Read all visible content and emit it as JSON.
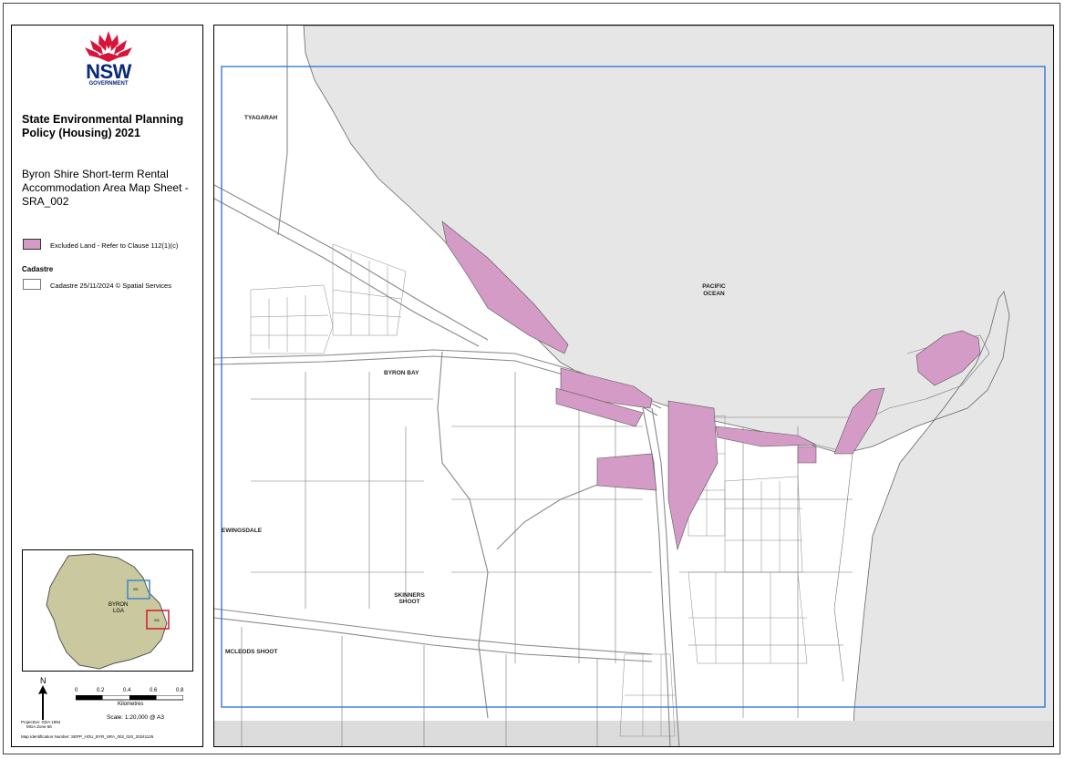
{
  "logo": {
    "wordmark": "NSW",
    "sub": "GOVERNMENT"
  },
  "title": "State Environmental Planning Policy (Housing) 2021",
  "subtitle": "Byron Shire Short-term Rental Accommodation Area Map Sheet - SRA_002",
  "legend": {
    "excluded_label": "Excluded Land - Refer to Clause 112(1)(c)",
    "excluded_color": "#d39bc6",
    "cadastre_heading": "Cadastre",
    "cadastre_label": "Cadastre 25/11/2024 © Spatial Services"
  },
  "inset": {
    "lga_label_1": "BYRON",
    "lga_label_2": "LGA",
    "sheet_a": "001",
    "sheet_b": "002",
    "lga_color": "#c9c89e"
  },
  "north": "N",
  "scale": {
    "ticks": [
      "0",
      "0.2",
      "0.4",
      "0.6",
      "0.8"
    ],
    "units": "Kilometres",
    "text": "Scale: 1:20,000 @ A3"
  },
  "projection": [
    "Projection: GDA 1994",
    "MGA Zone 56"
  ],
  "map_id": "Map Identification Number: SEPP_HOU_BYR_SRA_002_020_20241125",
  "map": {
    "ocean_color": "#e6e6e6",
    "extent_color": "#2a6fd6",
    "labels": {
      "tyagarah": "TYAGARAH",
      "pacific_1": "PACIFIC",
      "pacific_2": "OCEAN",
      "byron_bay": "BYRON BAY",
      "ewingsdale": "EWINGSDALE",
      "skinners_1": "SKINNERS",
      "skinners_2": "SHOOT",
      "mcleods": "MCLEODS SHOOT"
    }
  }
}
